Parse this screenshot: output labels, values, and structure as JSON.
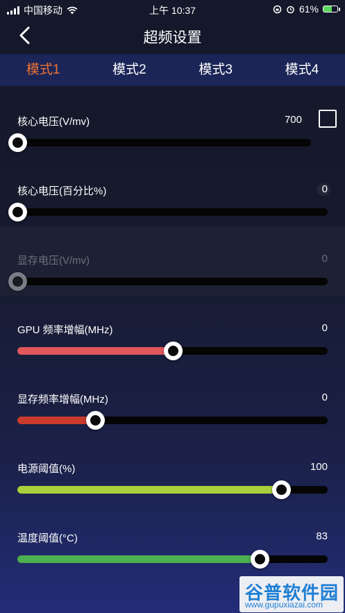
{
  "status": {
    "carrier": "中国移动",
    "time": "上午 10:37",
    "battery_percent": "61%",
    "battery_level": 0.61,
    "icons": [
      "signal-icon",
      "wifi-icon",
      "rotation-lock-icon",
      "alarm-icon",
      "battery-icon"
    ]
  },
  "nav": {
    "title": "超频设置",
    "back_icon": "chevron-left-icon"
  },
  "tabs": [
    {
      "label": "模式1",
      "active": true
    },
    {
      "label": "模式2",
      "active": false
    },
    {
      "label": "模式3",
      "active": false
    },
    {
      "label": "模式4",
      "active": false
    }
  ],
  "sliders": [
    {
      "label": "核心电压(V/mv)",
      "value": "700",
      "level": 0,
      "fill_color": "",
      "disabled": false,
      "checkbox": true
    },
    {
      "label": "核心电压(百分比%)",
      "value": "0",
      "level": 0,
      "fill_color": "",
      "disabled": false,
      "checkbox": false
    },
    {
      "label": "显存电压(V/mv)",
      "value": "0",
      "level": 0,
      "fill_color": "",
      "disabled": true,
      "checkbox": false
    },
    {
      "label": "GPU 频率增幅(MHz)",
      "value": "0",
      "level": 0.5,
      "fill_color": "#e0575c",
      "disabled": false,
      "checkbox": false
    },
    {
      "label": "显存频率增幅(MHz)",
      "value": "0",
      "level": 0.25,
      "fill_color": "#c93a2e",
      "disabled": false,
      "checkbox": false
    },
    {
      "label": "电源阈值(%)",
      "value": "100",
      "level": 0.85,
      "fill_color": "#aacf3c",
      "disabled": false,
      "checkbox": false
    },
    {
      "label": "温度阈值(°C)",
      "value": "83",
      "level": 0.78,
      "fill_color": "#4caf50",
      "disabled": false,
      "checkbox": false
    }
  ],
  "watermark": {
    "text": "谷普软件园",
    "url": "www.gupuxiazai.com"
  }
}
